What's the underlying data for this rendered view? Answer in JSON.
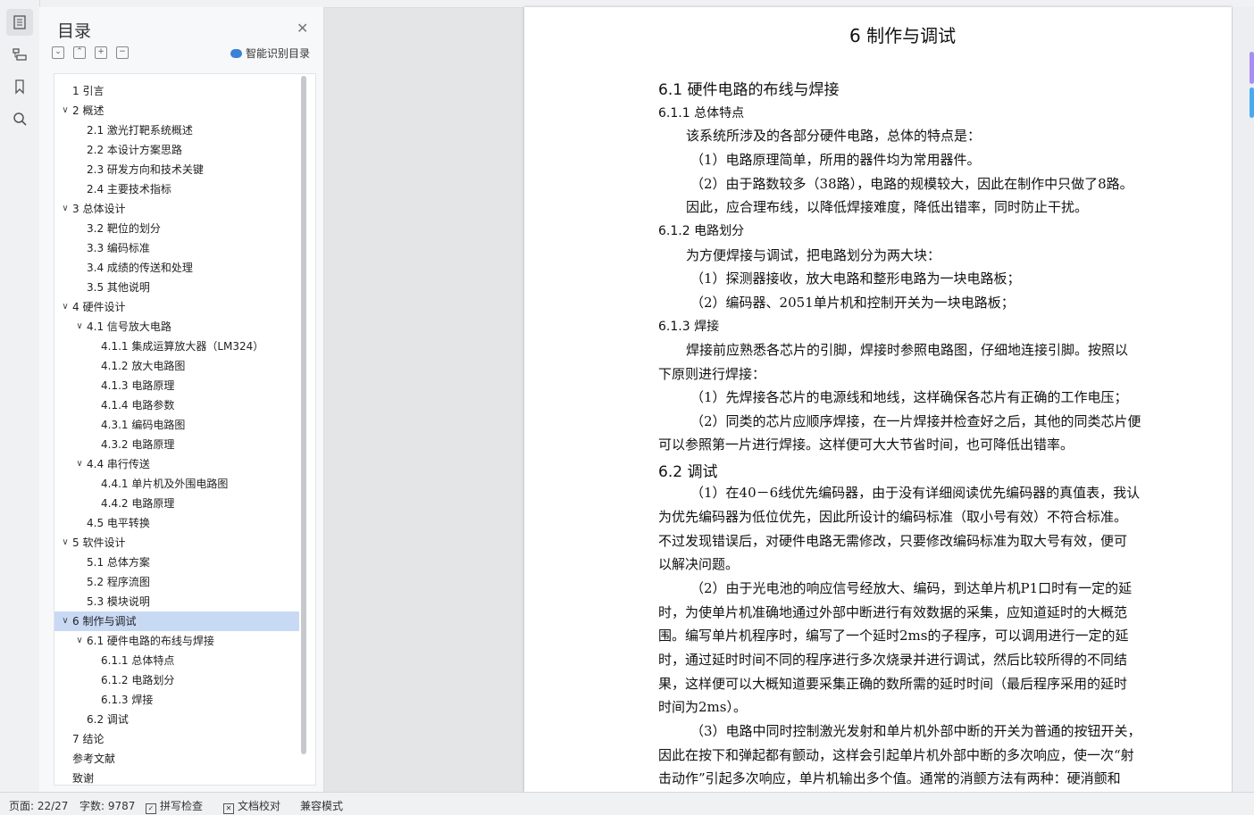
{
  "toc": {
    "title": "目录",
    "smart_label": "智能识别目录",
    "items": [
      {
        "num": "1",
        "text": "引言",
        "level": 1,
        "chev": false
      },
      {
        "num": "2",
        "text": "概述",
        "level": 1,
        "chev": true
      },
      {
        "num": "2.1",
        "text": "激光打靶系统概述",
        "level": 2,
        "chev": false
      },
      {
        "num": "2.2",
        "text": "本设计方案思路",
        "level": 2,
        "chev": false
      },
      {
        "num": "2.3",
        "text": "研发方向和技术关键",
        "level": 2,
        "chev": false
      },
      {
        "num": "2.4",
        "text": "主要技术指标",
        "level": 2,
        "chev": false
      },
      {
        "num": "3",
        "text": "总体设计",
        "level": 1,
        "chev": true
      },
      {
        "num": "3.2",
        "text": "靶位的划分",
        "level": 2,
        "chev": false
      },
      {
        "num": "3.3",
        "text": " 编码标准",
        "level": 2,
        "chev": false
      },
      {
        "num": "3.4",
        "text": "成绩的传送和处理",
        "level": 2,
        "chev": false
      },
      {
        "num": "3.5",
        "text": "其他说明",
        "level": 2,
        "chev": false
      },
      {
        "num": "4",
        "text": "硬件设计",
        "level": 1,
        "chev": true
      },
      {
        "num": "4.1",
        "text": "信号放大电路",
        "level": 2,
        "chev": true
      },
      {
        "num": "4.1.1",
        "text": "集成运算放大器（LM324）",
        "level": 3,
        "chev": false
      },
      {
        "num": "4.1.2",
        "text": "放大电路图",
        "level": 3,
        "chev": false
      },
      {
        "num": "4.1.3",
        "text": "电路原理",
        "level": 3,
        "chev": false
      },
      {
        "num": "4.1.4",
        "text": "电路参数",
        "level": 3,
        "chev": false
      },
      {
        "num": "4.3.1",
        "text": "编码电路图",
        "level": 3,
        "chev": false
      },
      {
        "num": "4.3.2",
        "text": "电路原理",
        "level": 3,
        "chev": false
      },
      {
        "num": "4.4",
        "text": "串行传送",
        "level": 2,
        "chev": true
      },
      {
        "num": "4.4.1",
        "text": "单片机及外围电路图",
        "level": 3,
        "chev": false
      },
      {
        "num": "4.4.2",
        "text": "电路原理",
        "level": 3,
        "chev": false
      },
      {
        "num": "4.5",
        "text": "电平转换",
        "level": 2,
        "chev": false
      },
      {
        "num": "5",
        "text": "软件设计",
        "level": 1,
        "chev": true
      },
      {
        "num": "5.1",
        "text": "总体方案",
        "level": 2,
        "chev": false
      },
      {
        "num": "5.2",
        "text": "程序流图",
        "level": 2,
        "chev": false
      },
      {
        "num": "5.3",
        "text": "模块说明",
        "level": 2,
        "chev": false
      },
      {
        "num": "6",
        "text": "制作与调试",
        "level": 1,
        "chev": true,
        "selected": true
      },
      {
        "num": "6.1",
        "text": "硬件电路的布线与焊接",
        "level": 2,
        "chev": true
      },
      {
        "num": "6.1.1",
        "text": "总体特点",
        "level": 3,
        "chev": false
      },
      {
        "num": "6.1.2",
        "text": "电路划分",
        "level": 3,
        "chev": false
      },
      {
        "num": "6.1.3",
        "text": "焊接",
        "level": 3,
        "chev": false
      },
      {
        "num": "6.2",
        "text": "调试",
        "level": 2,
        "chev": false
      },
      {
        "num": "7",
        "text": "结论",
        "level": 1,
        "chev": false
      },
      {
        "num": "",
        "text": "参考文献",
        "level": 0,
        "chev": false
      },
      {
        "num": "",
        "text": "致谢",
        "level": 0,
        "chev": false
      }
    ]
  },
  "doc": {
    "lines": [
      {
        "t": "6    制作与调试",
        "cls": "h1"
      },
      {
        "t": "6.1    硬件电路的布线与焊接",
        "cls": "h2"
      },
      {
        "t": "6.1.1    总体特点",
        "cls": "h3"
      },
      {
        "t": "该系统所涉及的各部分硬件电路，总体的特点是：",
        "cls": ""
      },
      {
        "t": "（1）电路原理简单，所用的器件均为常用器件。",
        "cls": ""
      },
      {
        "t": "（2）由于路数较多（38路），电路的规模较大，因此在制作中只做了8路。",
        "cls": ""
      },
      {
        "t": "因此，应合理布线，以降低焊接难度，降低出错率，同时防止干扰。",
        "cls": ""
      },
      {
        "t": "6.1.2    电路划分",
        "cls": "h3"
      },
      {
        "t": "为方便焊接与调试，把电路划分为两大块：",
        "cls": ""
      },
      {
        "t": "（1）探测器接收，放大电路和整形电路为一块电路板；",
        "cls": ""
      },
      {
        "t": "（2）编码器、2051单片机和控制开关为一块电路板；",
        "cls": ""
      },
      {
        "t": "6.1.3    焊接",
        "cls": "h3"
      },
      {
        "t": "焊接前应熟悉各芯片的引脚，焊接时参照电路图，仔细地连接引脚。按照以",
        "cls": ""
      },
      {
        "t": "下原则进行焊接：",
        "cls": ""
      },
      {
        "t": "（1）先焊接各芯片的电源线和地线，这样确保各芯片有正确的工作电压；",
        "cls": ""
      },
      {
        "t": "（2）同类的芯片应顺序焊接，在一片焊接并检查好之后，其他的同类芯片便",
        "cls": ""
      },
      {
        "t": "可以参照第一片进行焊接。这样便可大大节省时间，也可降低出错率。",
        "cls": ""
      },
      {
        "t": "6.2    调试",
        "cls": "h2"
      },
      {
        "t": "（1）在40－6线优先编码器，由于没有详细阅读优先编码器的真值表，我认",
        "cls": ""
      },
      {
        "t": "为优先编码器为低位优先，因此所设计的编码标准（取小号有效）不符合标准。",
        "cls": ""
      },
      {
        "t": "不过发现错误后，对硬件电路无需修改，只要修改编码标准为取大号有效，便可",
        "cls": ""
      },
      {
        "t": "以解决问题。",
        "cls": ""
      },
      {
        "t": "（2）由于光电池的响应信号经放大、编码，到达单片机P1口时有一定的延",
        "cls": ""
      },
      {
        "t": "时，为使单片机准确地通过外部中断进行有效数据的采集，应知道延时的大概范",
        "cls": ""
      },
      {
        "t": "围。编写单片机程序时，编写了一个延时2ms的子程序，可以调用进行一定的延",
        "cls": ""
      },
      {
        "t": "时，通过延时时间不同的程序进行多次烧录并进行调试，然后比较所得的不同结",
        "cls": ""
      },
      {
        "t": "果，这样便可以大概知道要采集正确的数所需的延时时间（最后程序采用的延时",
        "cls": ""
      },
      {
        "t": "时间为2ms）。",
        "cls": ""
      },
      {
        "t": "（3）电路中同时控制激光发射和单片机外部中断的开关为普通的按钮开关，",
        "cls": ""
      },
      {
        "t": "因此在按下和弹起都有颤动，这样会引起单片机外部中断的多次响应，使一次“射",
        "cls": ""
      },
      {
        "t": "击动作”引起多次响应，单片机输出多个值。通常的消颤方法有两种：硬消颤和",
        "cls": ""
      }
    ]
  },
  "status": {
    "page": "页面: 22/27",
    "words": "字数: 9787",
    "spell": "拼写检查",
    "proof": "文档校对",
    "compat": "兼容模式"
  }
}
